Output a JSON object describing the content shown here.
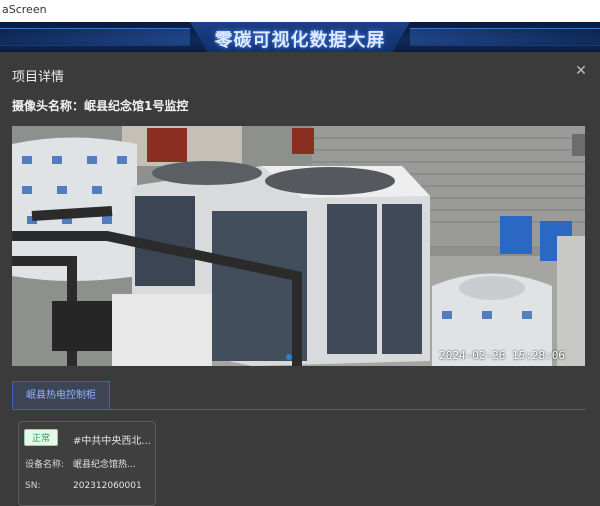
{
  "browser": {
    "tab_title": "aScreen"
  },
  "banner": {
    "title": "零碳可视化数据大屏"
  },
  "modal": {
    "title": "项目详情",
    "close_icon": "close-icon",
    "camera_label": "摄像头名称：岷县纪念馆1号监控"
  },
  "video": {
    "timestamp": "2024-02-26 15:28:06"
  },
  "tabs": [
    {
      "label": "岷县热电控制柜",
      "active": true
    }
  ],
  "device": {
    "status": "正常",
    "location": "#中共中央西北...",
    "name_label": "设备名称:",
    "name_value": "岷县纪念馆热...",
    "sn_label": "SN:",
    "sn_value": "202312060001"
  },
  "colors": {
    "accent": "#3c62b8",
    "status_ok": "#19a34a",
    "banner_bg": "#102a5a"
  }
}
